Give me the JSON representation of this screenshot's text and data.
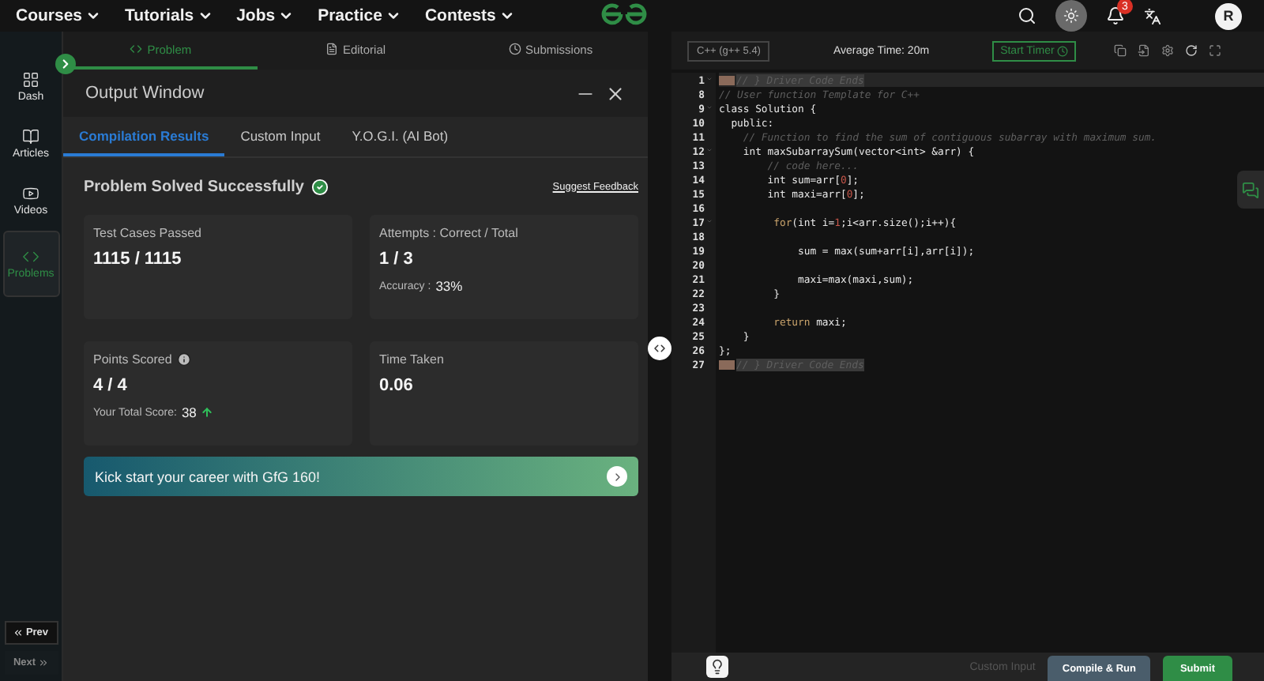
{
  "top_nav": {
    "menu": [
      {
        "label": "Courses"
      },
      {
        "label": "Tutorials"
      },
      {
        "label": "Jobs"
      },
      {
        "label": "Practice"
      },
      {
        "label": "Contests"
      }
    ],
    "notifications_badge": "3",
    "avatar": "R"
  },
  "sidebar": {
    "items": [
      {
        "label": "Dash",
        "selected": false
      },
      {
        "label": "Articles",
        "selected": false
      },
      {
        "label": "Videos",
        "selected": false
      },
      {
        "label": "Problems",
        "selected": true
      }
    ],
    "prev": "Prev",
    "next": "Next"
  },
  "problem_tabs": [
    {
      "label": "Problem",
      "selected": true
    },
    {
      "label": "Editorial",
      "selected": false
    },
    {
      "label": "Submissions",
      "selected": false
    }
  ],
  "output_window": {
    "title": "Output Window",
    "tabs": [
      {
        "label": "Compilation Results",
        "selected": true
      },
      {
        "label": "Custom Input",
        "selected": false
      },
      {
        "label": "Y.O.G.I. (AI Bot)",
        "selected": false
      }
    ],
    "status": "Problem Solved Successfully",
    "feedback_link": "Suggest Feedback",
    "cards": [
      {
        "label": "Test Cases Passed",
        "value": "1115 / 1115"
      },
      {
        "label": "Attempts : Correct / Total",
        "value": "1 / 3",
        "note_label": "Accuracy :",
        "note_value": "33%"
      },
      {
        "label": "Points Scored",
        "info": true,
        "value": "4 / 4",
        "note_label": "Your Total Score:",
        "note_value": "38",
        "rising": true
      },
      {
        "label": "Time Taken",
        "value": "0.06"
      }
    ],
    "banner": "Kick start your career with GfG 160!"
  },
  "editor": {
    "language": "C++ (g++ 5.4)",
    "average_time": "Average Time: 20m",
    "timer_button": "Start Timer",
    "lines": [
      {
        "number": "1",
        "foldable": true,
        "folded": true,
        "tokens": [
          {
            "t": "// } Driver Code Ends",
            "kind": "comment"
          }
        ]
      },
      {
        "number": "8",
        "foldable": false,
        "folded": false,
        "tokens": [
          {
            "t": "// User function Template for C++",
            "kind": "comment"
          }
        ]
      },
      {
        "number": "9",
        "foldable": true,
        "folded": false,
        "tokens": [
          {
            "t": "class Solution {",
            "kind": "plain"
          }
        ]
      },
      {
        "number": "10",
        "foldable": false,
        "folded": false,
        "tokens": [
          {
            "t": "  public:",
            "kind": "plain"
          }
        ]
      },
      {
        "number": "11",
        "foldable": false,
        "folded": false,
        "tokens": [
          {
            "t": "    // Function to find the sum of contiguous subarray with maximum sum.",
            "kind": "comment"
          }
        ]
      },
      {
        "number": "12",
        "foldable": true,
        "folded": false,
        "tokens": [
          {
            "t": "    int maxSubarraySum(vector<int> &arr) {",
            "kind": "plain"
          }
        ]
      },
      {
        "number": "13",
        "foldable": false,
        "folded": false,
        "tokens": [
          {
            "t": "        // code here...",
            "kind": "comment"
          }
        ]
      },
      {
        "number": "14",
        "foldable": false,
        "folded": false,
        "tokens": [
          {
            "t": "        int sum=arr[",
            "kind": "plain"
          },
          {
            "t": "0",
            "kind": "number"
          },
          {
            "t": "];",
            "kind": "plain"
          }
        ]
      },
      {
        "number": "15",
        "foldable": false,
        "folded": false,
        "tokens": [
          {
            "t": "        int maxi=arr[",
            "kind": "plain"
          },
          {
            "t": "0",
            "kind": "number"
          },
          {
            "t": "];",
            "kind": "plain"
          }
        ]
      },
      {
        "number": "16",
        "foldable": false,
        "folded": false
      },
      {
        "number": "17",
        "foldable": true,
        "folded": false,
        "tokens": [
          {
            "t": "         for",
            "kind": "keyword"
          },
          {
            "t": "(int i=",
            "kind": "plain"
          },
          {
            "t": "1",
            "kind": "number"
          },
          {
            "t": ";i<arr.size();i++){",
            "kind": "plain"
          }
        ]
      },
      {
        "number": "18",
        "foldable": false,
        "folded": false
      },
      {
        "number": "19",
        "foldable": false,
        "folded": false,
        "tokens": [
          {
            "t": "             sum = max(sum+arr[i],arr[i]);",
            "kind": "plain"
          }
        ]
      },
      {
        "number": "20",
        "foldable": false,
        "folded": false
      },
      {
        "number": "21",
        "foldable": false,
        "folded": false,
        "tokens": [
          {
            "t": "             maxi=max(maxi,sum);",
            "kind": "plain"
          }
        ]
      },
      {
        "number": "22",
        "foldable": false,
        "folded": false,
        "tokens": [
          {
            "t": "         }",
            "kind": "plain"
          }
        ]
      },
      {
        "number": "23",
        "foldable": false,
        "folded": false
      },
      {
        "number": "24",
        "foldable": false,
        "folded": false,
        "tokens": [
          {
            "t": "         return",
            "kind": "keyword"
          },
          {
            "t": " maxi;",
            "kind": "plain"
          }
        ]
      },
      {
        "number": "25",
        "foldable": false,
        "folded": false,
        "tokens": [
          {
            "t": "    }",
            "kind": "plain"
          }
        ]
      },
      {
        "number": "26",
        "foldable": false,
        "folded": false,
        "tokens": [
          {
            "t": "};",
            "kind": "plain"
          }
        ]
      },
      {
        "number": "27",
        "foldable": false,
        "folded": true,
        "tokens": [
          {
            "t": "// } Driver Code Ends",
            "kind": "comment"
          }
        ]
      }
    ]
  },
  "footer": {
    "custom_input": "Custom Input",
    "compile_button": "Compile & Run",
    "submit_button": "Submit"
  }
}
